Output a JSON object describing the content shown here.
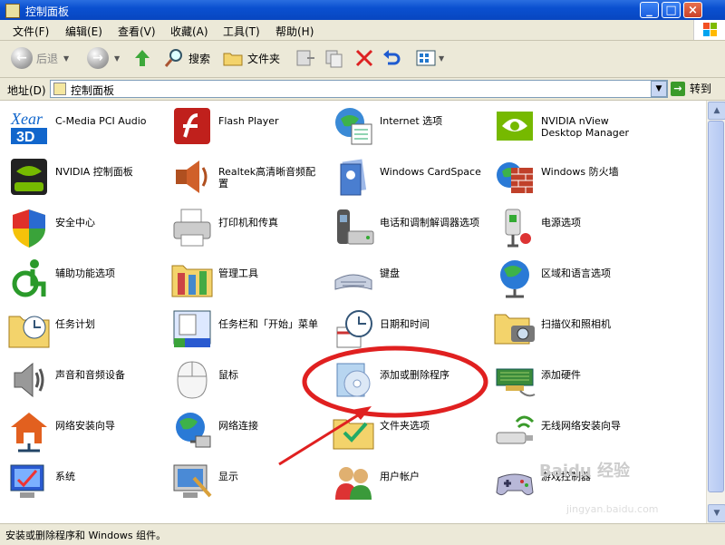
{
  "window": {
    "title": "控制面板"
  },
  "menu": [
    "文件(F)",
    "编辑(E)",
    "查看(V)",
    "收藏(A)",
    "工具(T)",
    "帮助(H)"
  ],
  "toolbar": {
    "back": "后退",
    "search": "搜索",
    "folders": "文件夹"
  },
  "address": {
    "label": "地址(D)",
    "value": "控制面板",
    "go": "转到"
  },
  "items": [
    {
      "label": "C-Media PCI Audio",
      "icon": "xear3d-icon"
    },
    {
      "label": "Flash Player",
      "icon": "flash-icon"
    },
    {
      "label": "Internet 选项",
      "icon": "internet-options-icon"
    },
    {
      "label": "NVIDIA nView Desktop Manager",
      "icon": "nvidia-nview-icon"
    },
    {
      "label": "NVIDIA 控制面板",
      "icon": "nvidia-panel-icon"
    },
    {
      "label": "Realtek高清晰音频配置",
      "icon": "realtek-speaker-icon"
    },
    {
      "label": "Windows CardSpace",
      "icon": "cardspace-icon"
    },
    {
      "label": "Windows 防火墙",
      "icon": "firewall-icon"
    },
    {
      "label": "安全中心",
      "icon": "security-shield-icon"
    },
    {
      "label": "打印机和传真",
      "icon": "printer-icon"
    },
    {
      "label": "电话和调制解调器选项",
      "icon": "phone-modem-icon"
    },
    {
      "label": "电源选项",
      "icon": "power-icon"
    },
    {
      "label": "辅助功能选项",
      "icon": "accessibility-icon"
    },
    {
      "label": "管理工具",
      "icon": "admin-tools-icon"
    },
    {
      "label": "键盘",
      "icon": "keyboard-icon"
    },
    {
      "label": "区域和语言选项",
      "icon": "globe-icon"
    },
    {
      "label": "任务计划",
      "icon": "scheduled-tasks-icon"
    },
    {
      "label": "任务栏和「开始」菜单",
      "icon": "taskbar-icon"
    },
    {
      "label": "日期和时间",
      "icon": "clock-icon"
    },
    {
      "label": "扫描仪和照相机",
      "icon": "scanner-camera-icon"
    },
    {
      "label": "声音和音频设备",
      "icon": "speaker-icon"
    },
    {
      "label": "鼠标",
      "icon": "mouse-icon"
    },
    {
      "label": "添加或删除程序",
      "icon": "add-remove-programs-icon"
    },
    {
      "label": "添加硬件",
      "icon": "add-hardware-icon"
    },
    {
      "label": "网络安装向导",
      "icon": "network-setup-icon"
    },
    {
      "label": "网络连接",
      "icon": "network-connections-icon"
    },
    {
      "label": "文件夹选项",
      "icon": "folder-options-icon"
    },
    {
      "label": "无线网络安装向导",
      "icon": "wireless-icon"
    },
    {
      "label": "系统",
      "icon": "system-icon"
    },
    {
      "label": "显示",
      "icon": "display-icon"
    },
    {
      "label": "用户帐户",
      "icon": "user-accounts-icon"
    },
    {
      "label": "游戏控制器",
      "icon": "game-controller-icon"
    }
  ],
  "status": "安装或删除程序和 Windows 组件。",
  "watermark": {
    "brand": "Baidu 经验",
    "url": "jingyan.baidu.com"
  },
  "colors": {
    "title": "#0a50d0",
    "chrome": "#ece9d8",
    "highlight": "#e02020"
  }
}
